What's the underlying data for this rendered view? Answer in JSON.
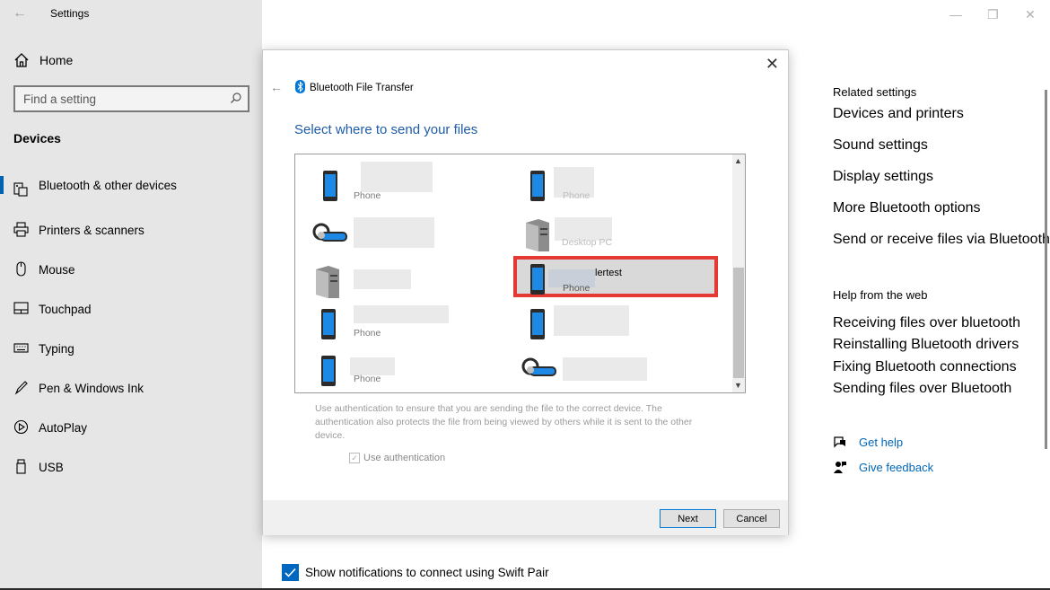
{
  "app": {
    "title": "Settings"
  },
  "sidebar": {
    "home": "Home",
    "search_placeholder": "Find a setting",
    "section": "Devices",
    "items": [
      {
        "label": "Bluetooth & other devices",
        "icon": "bluetooth-devices-icon",
        "active": true
      },
      {
        "label": "Printers & scanners",
        "icon": "printer-icon"
      },
      {
        "label": "Mouse",
        "icon": "mouse-icon"
      },
      {
        "label": "Touchpad",
        "icon": "touchpad-icon"
      },
      {
        "label": "Typing",
        "icon": "keyboard-icon"
      },
      {
        "label": "Pen & Windows Ink",
        "icon": "pen-icon"
      },
      {
        "label": "AutoPlay",
        "icon": "autoplay-icon"
      },
      {
        "label": "USB",
        "icon": "usb-icon"
      }
    ]
  },
  "related": {
    "heading": "Related settings",
    "links": [
      "Devices and printers",
      "Sound settings",
      "Display settings",
      "More Bluetooth options",
      "Send or receive files via Bluetooth"
    ]
  },
  "help": {
    "heading": "Help from the web",
    "links": [
      "Receiving files over bluetooth",
      "Reinstalling Bluetooth drivers",
      "Fixing Bluetooth connections",
      "Sending files over Bluetooth"
    ]
  },
  "support": {
    "get_help": "Get help",
    "give_feedback": "Give feedback"
  },
  "swift_pair": {
    "label": "Show notifications to connect using Swift Pair",
    "checked": true
  },
  "dialog": {
    "title": "Bluetooth File Transfer",
    "heading": "Select where to send your files",
    "devices": [
      {
        "type": "Phone",
        "col": 0
      },
      {
        "type": "Phone",
        "col": 1
      },
      {
        "type": "",
        "col": 0
      },
      {
        "type": "Desktop PC",
        "col": 1
      },
      {
        "type": "",
        "col": 0
      },
      {
        "name": "lertest",
        "type": "Phone",
        "col": 1,
        "selected": true
      },
      {
        "type": "Phone",
        "col": 0
      },
      {
        "type": "",
        "col": 1
      },
      {
        "type": "Phone",
        "col": 0
      },
      {
        "type": "",
        "col": 1
      }
    ],
    "help_text": "Use authentication to ensure that you are sending the file to the correct device. The authentication also protects the file from being viewed by others while it is sent to the other device.",
    "auth_label": "Use authentication",
    "next": "Next",
    "cancel": "Cancel"
  },
  "colors": {
    "accent": "#0067c0",
    "link": "#0066b4",
    "highlight": "#e53935"
  }
}
